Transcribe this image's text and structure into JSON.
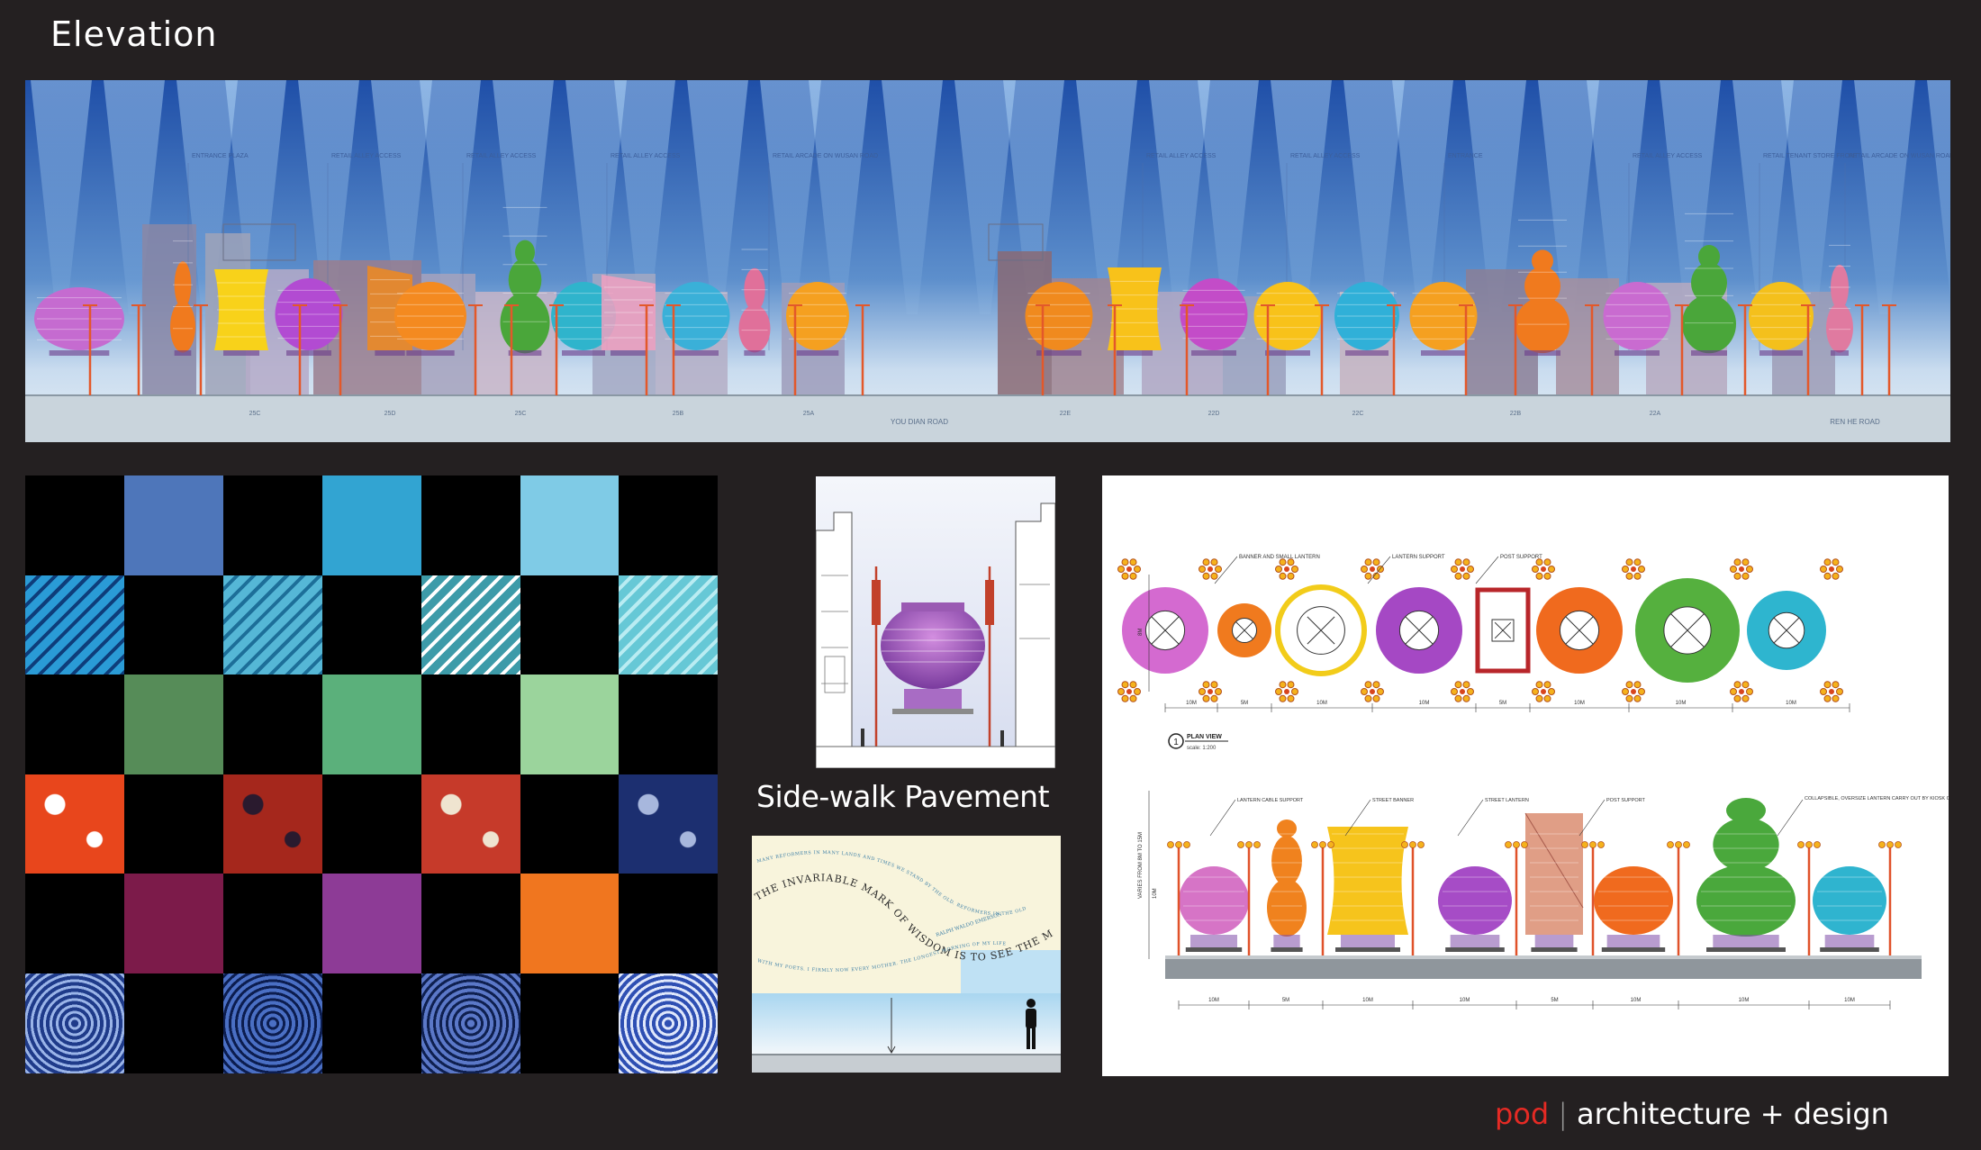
{
  "header": {
    "title": "Elevation"
  },
  "elevation": {
    "top_labels": [
      "ENTRANCE PLAZA",
      "RETAIL ALLEY ACCESS",
      "RETAIL ALLEY ACCESS",
      "RETAIL ALLEY ACCESS",
      "RETAIL ARCADE ON WUSAN ROAD",
      "RETAIL ALLEY ACCESS",
      "RETAIL ALLEY ACCESS",
      "ENTRANCE",
      "RETAIL ALLEY ACCESS",
      "RETAIL TENANT STORE FRONT",
      "RETAIL ARCADE ON WUSAN ROAD"
    ],
    "bottom_labels": [
      "25C",
      "25D",
      "25C",
      "25B",
      "25A",
      "YOU DIAN ROAD",
      "22E",
      "22D",
      "22C",
      "22B",
      "22A",
      "REN HE ROAD"
    ]
  },
  "swatches": {
    "rows": [
      [
        "#000000",
        "#4e76ba",
        "#000000",
        "#32a4d2",
        "#000000",
        "#7fcbe6",
        "#000000"
      ],
      [
        "tex:#2a9bd6:#0e3d7a",
        "#000000",
        "tex:#55b7d6:#1d6f99",
        "#000000",
        "tex:#3d9ba9:#ffffff",
        "#000000",
        "tex:#66c8d6:#b9ecf2"
      ],
      [
        "#000000",
        "#568c58",
        "#000000",
        "#5bb07b",
        "#000000",
        "#9bd49c",
        "#000000"
      ],
      [
        "tex:#e8461c:#ffffff",
        "#000000",
        "tex:#a5271c:#2a1a2e",
        "#000000",
        "tex:#c63a2a:#efe4d0",
        "#000000",
        "tex:#1c2f70:#a7b7dd"
      ],
      [
        "#000000",
        "#7c1b4a",
        "#000000",
        "#8d3b96",
        "#000000",
        "#f0761f",
        "#000000"
      ],
      [
        "tex:#1f3b8a:#9ab4e8",
        "#000000",
        "tex:#4a6fc4:#0c1d4f",
        "#000000",
        "tex:#5b78c8:#0f2050",
        "#000000",
        "tex:#2e4fb3:#dfe7fb"
      ]
    ]
  },
  "sidewalk": {
    "label": "Side-walk Pavement"
  },
  "pavement": {
    "quote_main": "THE INVARIABLE MARK OF WISDOM IS TO SEE THE MIRACULOUS IN THE COMMON.",
    "quote_author": "RALPH WALDO EMERSON",
    "quote_small_1": "MANY REFORMERS IN MANY LANDS AND TIMES WE STAND BY THE OLD. REFORMERS IN THE OLD",
    "quote_small_2": "WITH MY POETS. I FIRMLY NOW EVERY MOTHER. THE LONGEST MORNING OF MY LIFE"
  },
  "plan": {
    "callouts_top": [
      "BANNER AND SMALL LANTERN",
      "LANTERN SUPPORT",
      "POST SUPPORT"
    ],
    "dims_top": [
      "10M",
      "5M",
      "10M",
      "10M",
      "5M",
      "10M",
      "10M",
      "10M"
    ],
    "plan_view_number": "1",
    "plan_view_title": "PLAN VIEW",
    "plan_view_scale": "scale: 1:200",
    "callouts_bottom": [
      "LANTERN CABLE SUPPORT",
      "STREET BANNER",
      "STREET LANTERN",
      "POST SUPPORT",
      "COLLAPSIBLE, OVERSIZE LANTERN CARRY OUT BY KIOSK CAR FOR THE WUSAN NIGHT MARKET"
    ],
    "dims_bottom": [
      "10M",
      "5M",
      "10M",
      "10M",
      "5M",
      "10M",
      "10M",
      "10M"
    ],
    "height_label_top": "8M",
    "height_label_bottom": "VARIES FROM 8M TO 15M",
    "height_label_mid": "10M"
  },
  "footer": {
    "brand": "pod",
    "separator": "|",
    "tagline": "architecture + design"
  },
  "colors": {
    "background": "#242021",
    "brand_red": "#e52a24",
    "sky_top": "#1f4fa8",
    "sky_bottom": "#dce8f2"
  }
}
